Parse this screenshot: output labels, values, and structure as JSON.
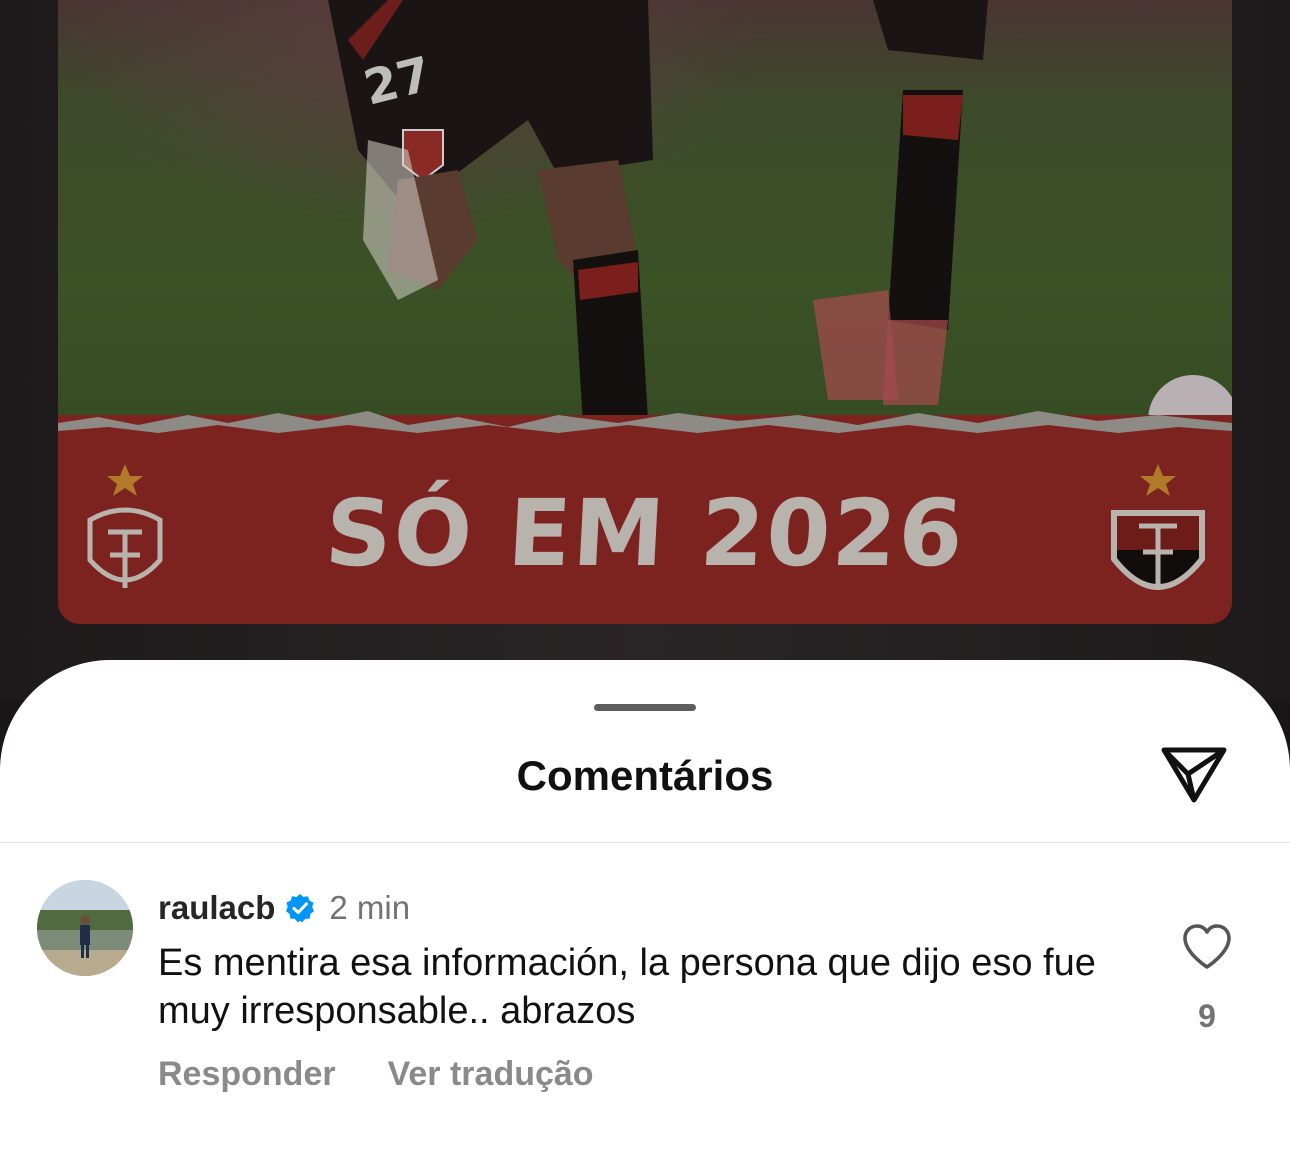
{
  "post": {
    "banner_text": "SÓ EM 2026",
    "player_number": "27"
  },
  "sheet": {
    "title": "Comentários",
    "share_icon": "send-icon"
  },
  "comment": {
    "username": "raulacb",
    "verified": true,
    "time": "2 min",
    "text": "Es mentira esa información, la persona que dijo eso fue muy irresponsable.. abrazos",
    "reply_label": "Responder",
    "translate_label": "Ver tradução",
    "like_count": "9"
  },
  "colors": {
    "verified_blue": "#0095f6",
    "banner_red": "#7c2320",
    "muted_text": "#8a8a8a"
  }
}
